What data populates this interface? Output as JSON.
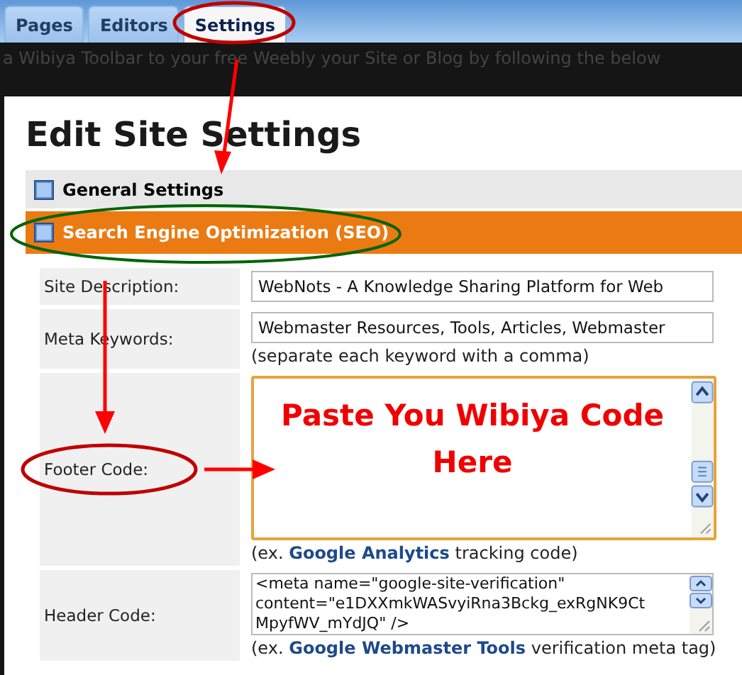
{
  "tabs": [
    {
      "label": "Pages",
      "selected": false
    },
    {
      "label": "Editors",
      "selected": false
    },
    {
      "label": "Settings",
      "selected": true
    }
  ],
  "banner_text": "a Wibiya Toolbar to your free Weebly your Site or Blog by following the below",
  "title": "Edit Site Settings",
  "sections": [
    {
      "label": "General Settings",
      "selected": false
    },
    {
      "label": "Search Engine Optimization (SEO)",
      "selected": true
    }
  ],
  "fields": [
    {
      "kind": "input",
      "label": "Site Description:",
      "value": "WebNots - A Knowledge Sharing Platform for Web"
    },
    {
      "kind": "input",
      "label": "Meta Keywords:",
      "value": "Webmaster Resources, Tools, Articles, Webmaster",
      "hint": {
        "text": "(separate each keyword with a comma)"
      }
    },
    {
      "kind": "textarea",
      "label": "Footer Code:",
      "value": "Paste You Wibiya Code Here",
      "hint": {
        "text": "(ex. ",
        "link": "Google Analytics",
        "after": " tracking code)"
      }
    },
    {
      "kind": "code",
      "label": "Header Code:",
      "lines": [
        "<meta name=\"google-site-verification\"",
        "content=\"e1DXXmkWASvyiRna3Bckg_exRgNK9Ct",
        "MpyfWV_mYdJQ\" />"
      ],
      "hint": {
        "text": "(ex. ",
        "link": "Google Webmaster Tools",
        "after": " verification meta tag)"
      }
    }
  ]
}
